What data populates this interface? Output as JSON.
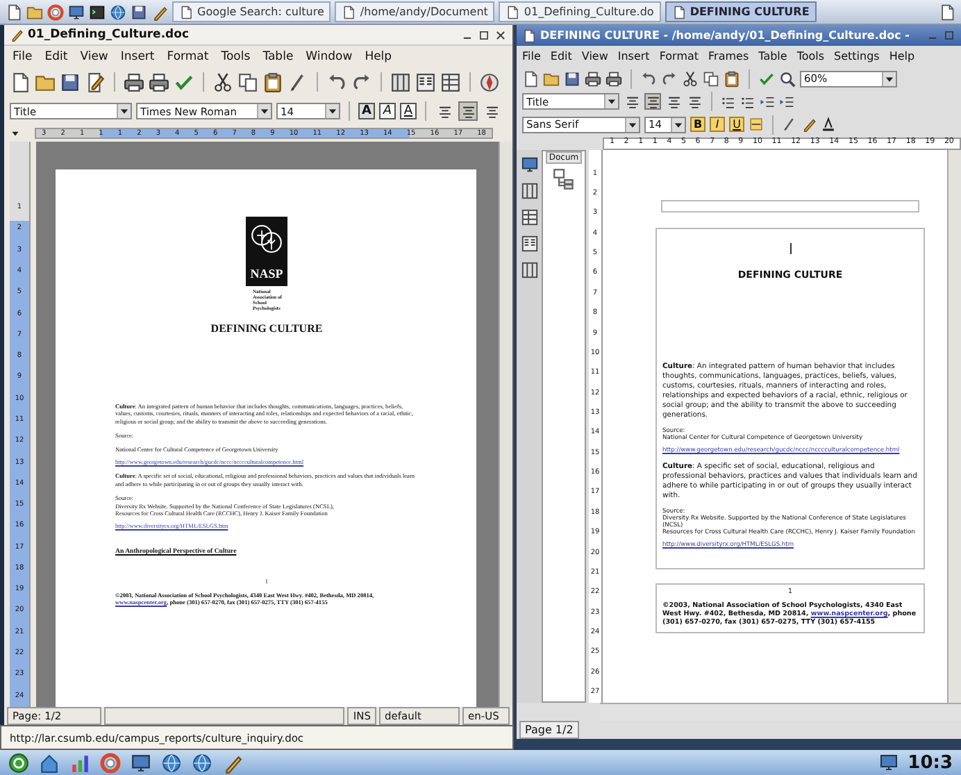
{
  "top_panel": {
    "tasks": [
      {
        "label": "Google Search: culture",
        "selected": false
      },
      {
        "label": "/home/andy/Document",
        "selected": false
      },
      {
        "label": "01_Defining_Culture.do",
        "selected": false
      },
      {
        "label": "DEFINING CULTURE",
        "selected": true
      }
    ]
  },
  "left_window": {
    "title": "01_Defining_Culture.doc",
    "menu": [
      "File",
      "Edit",
      "View",
      "Insert",
      "Format",
      "Tools",
      "Table",
      "Window",
      "Help"
    ],
    "style": "Title",
    "font": "Times New Roman",
    "size": "14",
    "char_buttons": [
      "A",
      "A",
      "A"
    ],
    "align_buttons": [
      {
        "selected": false
      },
      {
        "selected": true
      },
      {
        "selected": false
      }
    ],
    "ruler": [
      "3",
      "2",
      "1",
      "1",
      "1",
      "2",
      "3",
      "4",
      "5",
      "6",
      "7",
      "8",
      "9",
      "10",
      "11",
      "12",
      "13",
      "14",
      "15",
      "16",
      "17",
      "18"
    ],
    "vertical_ruler": [
      "1",
      "2",
      "3",
      "4",
      "5",
      "6",
      "7",
      "8",
      "9",
      "10",
      "11",
      "12",
      "13",
      "14",
      "15",
      "16",
      "17",
      "18",
      "19",
      "20",
      "21",
      "22",
      "23",
      "24"
    ],
    "document": [
      {
        "kind": "logo",
        "mark": "NASP",
        "caption": [
          "National",
          "Association of",
          "School",
          "Psychologists"
        ]
      },
      {
        "kind": "title",
        "text": "DEFINING CULTURE"
      },
      {
        "kind": "para",
        "text": "**Culture**: An integrated pattern of human behavior that includes thoughts, communications, languages, practices, beliefs, values, customs, courtesies, rituals, manners of interacting and roles, relationships and expected behaviors of a racial, ethnic, religious or social group; and the ability to transmit the above to succeeding generations."
      },
      {
        "kind": "source",
        "lines": [
          "Source:"
        ]
      },
      {
        "kind": "source",
        "lines": [
          "National Center for Cultural Competence of Georgetown University"
        ]
      },
      {
        "kind": "link",
        "text": "http://www.georgetown.edu/research/gucdc/nccc/ncccculturalcompetence.html"
      },
      {
        "kind": "para",
        "text": "**Culture**: A specific set of social, educational, religious and professional behaviors, practices and values that individuals learn and adhere to while participating in or out of groups they usually interact with."
      },
      {
        "kind": "source",
        "lines": [
          "Source:",
          "Diversity Rx Website. Supported by the National Conference of State Legislatures (NCSL),",
          "Resources for Cross Cultural Health Care (RCCHC), Henry J. Kaiser Family Foundation"
        ]
      },
      {
        "kind": "link",
        "text": "http://www.diversityrx.org/HTML/ESLGS.htm"
      },
      {
        "kind": "heading",
        "text": "An Anthropological Perspective of Culture"
      },
      {
        "kind": "pagenum",
        "text": "1"
      },
      {
        "kind": "footer",
        "before": "©2003, National Association of School Psychologists, 4340 East West Hwy. #402, Bethesda, MD 20814, ",
        "link": "www.naspcenter.org",
        "after": ", phone (301) 657-0270, fax (301) 657-0275, TTY (301) 657-4155"
      }
    ],
    "status_bar": {
      "page": "Page: 1/2",
      "mode": "INS",
      "page_style": "default",
      "language": "en-US"
    }
  },
  "link_tooltip": "http://lar.csumb.edu/campus_reports/culture_inquiry.doc",
  "right_window": {
    "title": "DEFINING CULTURE - /home/andy/01_Defining_Culture.doc -",
    "menu": [
      "File",
      "Edit",
      "View",
      "Insert",
      "Format",
      "Frames",
      "Table",
      "Tools",
      "Settings",
      "Help"
    ],
    "zoom": "60%",
    "style": "Title",
    "align_buttons": [
      {
        "selected": false
      },
      {
        "selected": true
      },
      {
        "selected": false
      },
      {
        "selected": false
      }
    ],
    "font": "Sans Serif",
    "size": "14",
    "char_buttons": [
      "B",
      "I",
      "U"
    ],
    "sidebar_tab": "Docum",
    "ruler": [
      "1",
      "2",
      "1",
      "1",
      "4",
      "5",
      "6",
      "7",
      "8",
      "9",
      "10",
      "11",
      "12",
      "13",
      "14",
      "15",
      "16",
      "17",
      "18",
      "19",
      "20"
    ],
    "vertical_ruler": [
      "1",
      "2",
      "3",
      "4",
      "5",
      "6",
      "7",
      "8",
      "9",
      "10",
      "11",
      "12",
      "13",
      "14",
      "15",
      "16",
      "17",
      "18",
      "19",
      "20",
      "21",
      "22",
      "23",
      "24",
      "25",
      "26",
      "27"
    ],
    "main_frame": [
      {
        "kind": "title",
        "text": "DEFINING CULTURE"
      },
      {
        "kind": "para",
        "text": "**Culture**: An integrated pattern of human behavior that includes thoughts, communications, languages, practices, beliefs, values, customs, courtesies, rituals, manners of interacting and roles, relationships and expected behaviors of a racial, ethnic, religious or social group; and the ability to transmit the above to succeeding generations."
      },
      {
        "kind": "source",
        "lines": [
          "Source:",
          "National Center for Cultural Competence of Georgetown University"
        ]
      },
      {
        "kind": "link",
        "text": "http://www.georgetown.edu/research/gucdc/nccc/ncccculturalcompetence.html"
      },
      {
        "kind": "para",
        "text": "**Culture**: A specific set of social, educational, religious and professional behaviors, practices and values that individuals learn and adhere to while participating in or out of groups they usually interact with."
      },
      {
        "kind": "source",
        "lines": [
          "Source:",
          "Diversity Rx Website. Supported by the National Conference of State Legislatures (NCSL)",
          "Resources for Cross Cultural Health Care (RCCHC), Henry J. Kaiser Family Foundation"
        ]
      },
      {
        "kind": "link",
        "text": "http://www.diversityrx.org/HTML/ESLGS.htm"
      }
    ],
    "footer_frame": [
      {
        "kind": "pagenum",
        "text": "1"
      },
      {
        "kind": "footer",
        "before": "©2003, National Association of School Psychologists, 4340 East West Hwy. #402, Bethesda, MD 20814, ",
        "link": "www.naspcenter.org",
        "after": ", phone (301) 657-0270, fax (301) 657-0275, TTY (301) 657-4155"
      }
    ],
    "status_bar": {
      "page": "Page 1/2"
    }
  },
  "bottom_panel": {
    "clock": "10:3"
  }
}
